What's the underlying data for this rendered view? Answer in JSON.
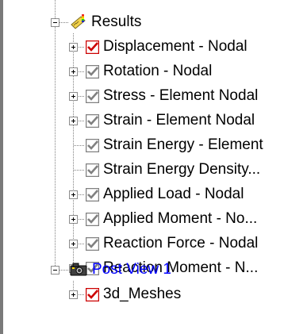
{
  "tree": {
    "top_clipped_text": "",
    "results": {
      "label": "Results",
      "icon": "results-icon",
      "children": [
        {
          "label": "Displacement - Nodal",
          "checked": true,
          "check_color": "#cc0000",
          "has_expander": true
        },
        {
          "label": "Rotation - Nodal",
          "checked": true,
          "check_color": "#808080",
          "has_expander": true
        },
        {
          "label": "Stress - Element Nodal",
          "checked": true,
          "check_color": "#808080",
          "has_expander": true
        },
        {
          "label": "Strain - Element Nodal",
          "checked": true,
          "check_color": "#808080",
          "has_expander": true
        },
        {
          "label": "Strain Energy - Element",
          "checked": true,
          "check_color": "#808080",
          "has_expander": false
        },
        {
          "label": "Strain Energy Density...",
          "checked": true,
          "check_color": "#808080",
          "has_expander": false
        },
        {
          "label": "Applied Load - Nodal",
          "checked": true,
          "check_color": "#808080",
          "has_expander": true
        },
        {
          "label": "Applied Moment - No...",
          "checked": true,
          "check_color": "#808080",
          "has_expander": true
        },
        {
          "label": "Reaction Force - Nodal",
          "checked": true,
          "check_color": "#808080",
          "has_expander": true
        },
        {
          "label": "Reaction Moment - N...",
          "checked": true,
          "check_color": "#808080",
          "has_expander": true
        }
      ]
    },
    "post_view": {
      "label": "Post View  1",
      "icon": "camera-icon",
      "color": "#0000ff",
      "children": [
        {
          "label": "3d_Meshes",
          "checked": true,
          "check_color": "#cc0000",
          "has_expander": true
        }
      ]
    }
  }
}
